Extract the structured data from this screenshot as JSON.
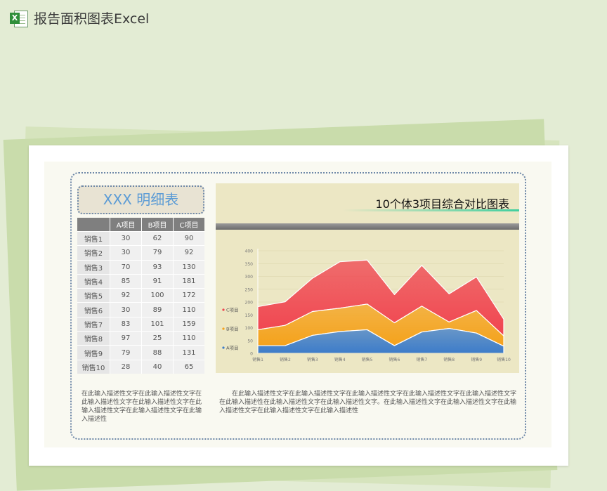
{
  "header": {
    "title": "报告面积图表Excel",
    "icon": "excel-icon"
  },
  "table": {
    "title": "XXX 明细表",
    "columns": [
      "",
      "A项目",
      "B项目",
      "C项目"
    ],
    "rows": [
      [
        "销售1",
        "30",
        "62",
        "90"
      ],
      [
        "销售2",
        "30",
        "79",
        "92"
      ],
      [
        "销售3",
        "70",
        "93",
        "130"
      ],
      [
        "销售4",
        "85",
        "91",
        "181"
      ],
      [
        "销售5",
        "92",
        "100",
        "172"
      ],
      [
        "销售6",
        "30",
        "89",
        "110"
      ],
      [
        "销售7",
        "83",
        "101",
        "159"
      ],
      [
        "销售8",
        "97",
        "25",
        "110"
      ],
      [
        "销售9",
        "79",
        "88",
        "131"
      ],
      [
        "销售10",
        "28",
        "40",
        "65"
      ]
    ]
  },
  "chart_data": {
    "type": "area",
    "title": "10个体3项目综合对比图表",
    "stacked": true,
    "categories": [
      "销售1",
      "销售2",
      "销售3",
      "销售4",
      "销售5",
      "销售6",
      "销售7",
      "销售8",
      "销售9",
      "销售10"
    ],
    "series": [
      {
        "name": "A项目",
        "values": [
          30,
          30,
          70,
          85,
          92,
          30,
          83,
          97,
          79,
          28
        ],
        "color": "#3d7cc9"
      },
      {
        "name": "B项目",
        "values": [
          62,
          79,
          93,
          91,
          100,
          89,
          101,
          25,
          88,
          40
        ],
        "color": "#f5a21c"
      },
      {
        "name": "C项目",
        "values": [
          90,
          92,
          130,
          181,
          172,
          110,
          159,
          110,
          131,
          65
        ],
        "color": "#f0444f"
      }
    ],
    "ylim": [
      0,
      400
    ],
    "yticks": [
      0,
      50,
      100,
      150,
      200,
      250,
      300,
      350,
      400
    ],
    "legend": [
      "C项目",
      "B项目",
      "A项目"
    ],
    "legend_position": "left",
    "grid": true
  },
  "description": {
    "left": "在此输入描述性文字在此输入描述性文字在此输入描述性文字在此输入描述性文字在此输入描述性文字在此输入描述性文字在此输入描述性",
    "right": "在此输入描述性文字在此输入描述性文字在此输入描述性文字在此输入描述性文字在此输入描述性文字在此输入描述性在此输入描述性文字在此输入描述性文字。在此输入描述性文字在此输入描述性文字在此输入描述性文字在此输入描述性文字在此输入描述性"
  }
}
